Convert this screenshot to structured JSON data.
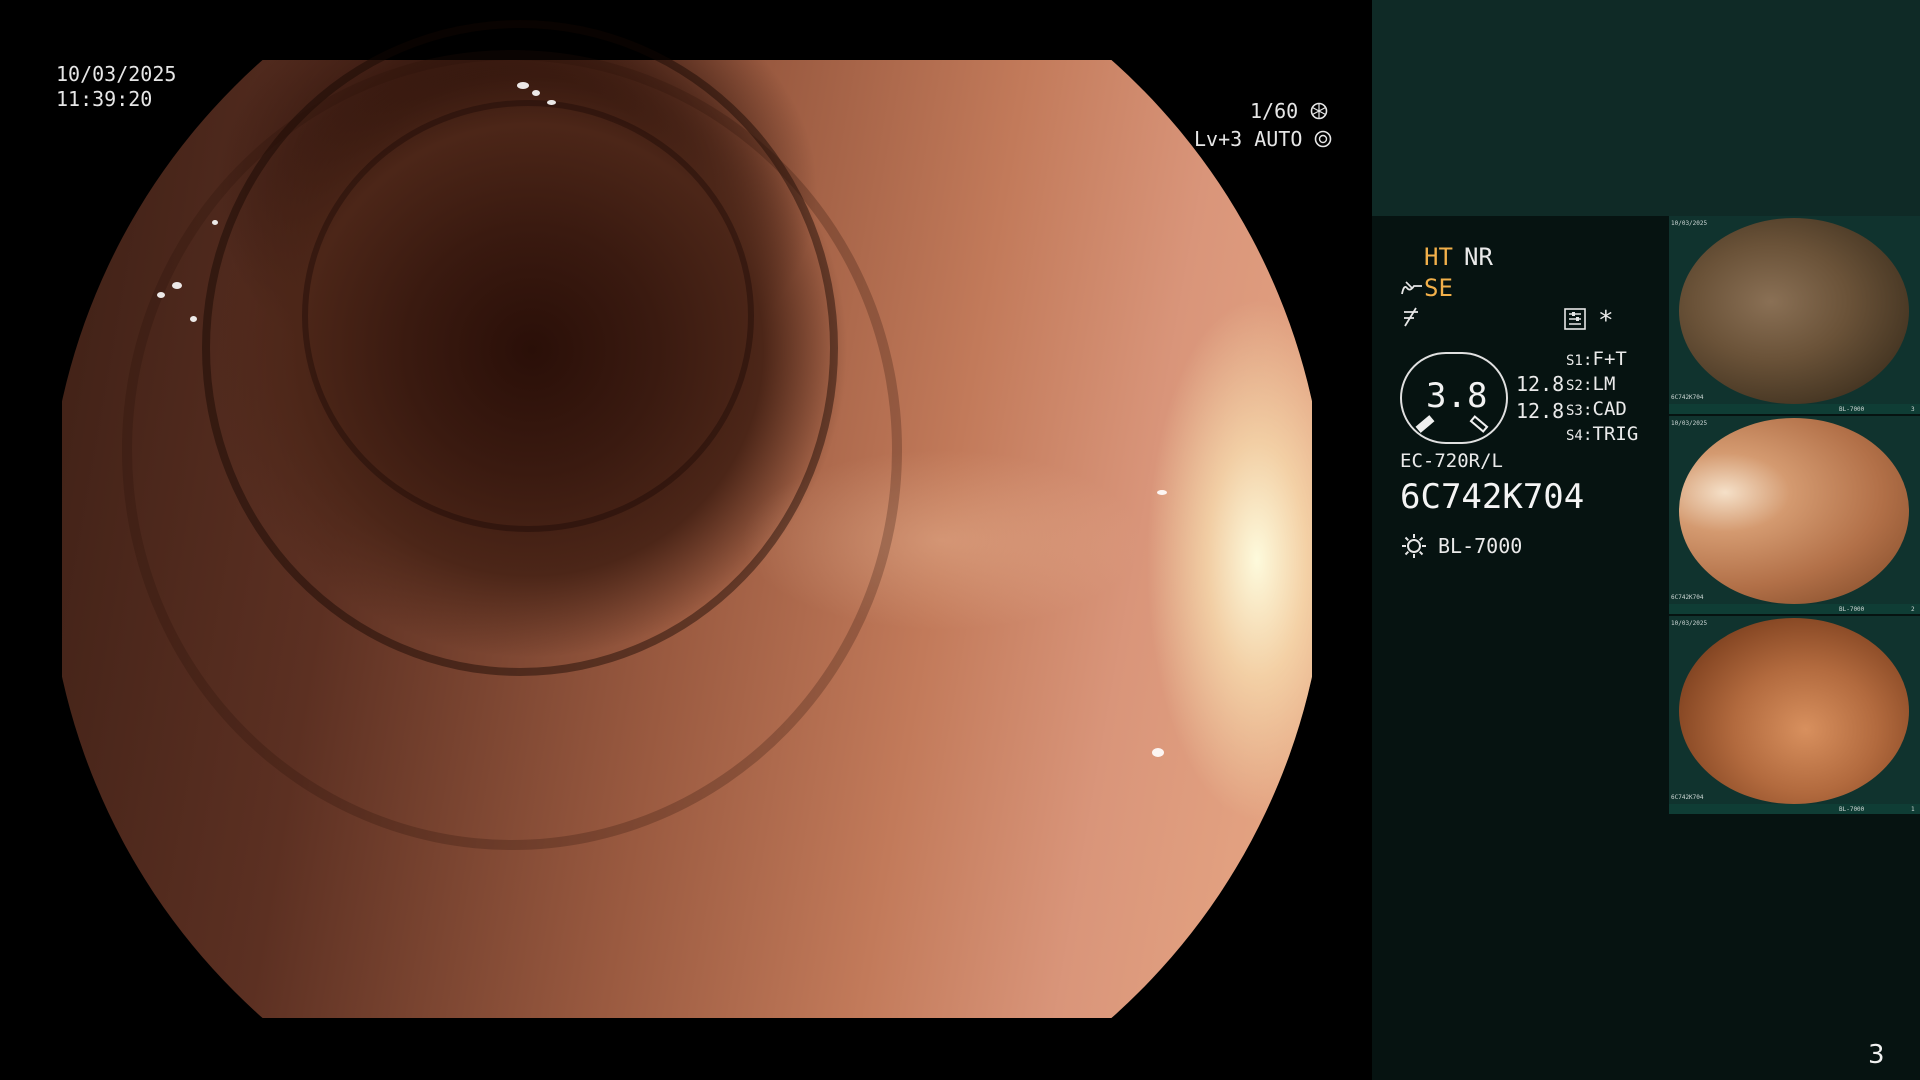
{
  "overlay": {
    "date": "10/03/2025",
    "time": "11:39:20",
    "shutter": "1/60",
    "shutter_icon": "shutter-icon",
    "level": "Lv+3",
    "exposure_mode": "AUTO",
    "exposure_icon": "iris-icon"
  },
  "panel": {
    "ht": "HT",
    "nr": "NR",
    "se": "SE",
    "se_icon": "structure-enhancement-icon",
    "color_icon": "color-enhancement-icon",
    "mode_icon": "settings-icon",
    "star": "*",
    "aperture_value": "3.8",
    "aperture_min": "12.8",
    "aperture_max": "12.8",
    "switches": [
      {
        "key": "S1",
        "value": "F+T"
      },
      {
        "key": "S2",
        "value": "LM"
      },
      {
        "key": "S3",
        "value": "CAD"
      },
      {
        "key": "S4",
        "value": "TRIG"
      }
    ],
    "scope_model": "EC-720R/L",
    "serial": "6C742K704",
    "light_icon": "light-source-icon",
    "light_source": "BL-7000",
    "page_number": "3"
  },
  "thumbnails": [
    {
      "info_top_left": "10/03/2025",
      "info_bottom_left": "6C742K704",
      "info_bottom_right": "BL-7000",
      "index": "3"
    },
    {
      "info_top_left": "10/03/2025",
      "info_bottom_left": "6C742K704",
      "info_bottom_right": "BL-7000",
      "index": "2"
    },
    {
      "info_top_left": "10/03/2025",
      "info_bottom_left": "6C742K704",
      "info_bottom_right": "BL-7000",
      "index": "1"
    }
  ],
  "colors": {
    "panel_bg": "#061311",
    "panel_header": "#0f2a26",
    "accent_orange": "#f2b04a",
    "thumb_frame": "#10332e"
  }
}
